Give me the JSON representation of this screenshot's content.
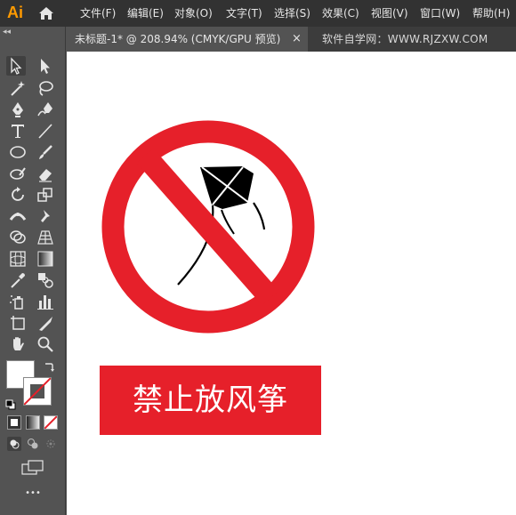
{
  "app": {
    "logo_text": "Ai",
    "logo_color": "#ff9a00"
  },
  "menu": {
    "items": [
      "文件(F)",
      "编辑(E)",
      "对象(O)",
      "文字(T)",
      "选择(S)",
      "效果(C)",
      "视图(V)",
      "窗口(W)",
      "帮助(H)"
    ]
  },
  "document": {
    "tab_title": "未标题-1* @ 208.94% (CMYK/GPU 预览)",
    "close_symbol": "×",
    "watermark": "软件自学网：WWW.RJZXW.COM"
  },
  "toolbar": {
    "collapse_symbol": "◂◂",
    "more_symbol": "•••",
    "tools": [
      "selection",
      "direct-selection",
      "magic-wand",
      "lasso",
      "pen",
      "curvature",
      "type",
      "line-segment",
      "ellipse",
      "paintbrush",
      "shaper",
      "eraser",
      "rotate",
      "scale",
      "width",
      "puppet-warp",
      "shape-builder",
      "perspective-grid",
      "mesh",
      "gradient",
      "eyedropper",
      "blend",
      "symbol-sprayer",
      "column-graph",
      "artboard",
      "slice",
      "hand",
      "zoom"
    ]
  },
  "artwork": {
    "sign_label": "禁止放风筝",
    "colors": {
      "red": "#e6202a",
      "kite": "#000000",
      "canvas": "#ffffff"
    }
  }
}
